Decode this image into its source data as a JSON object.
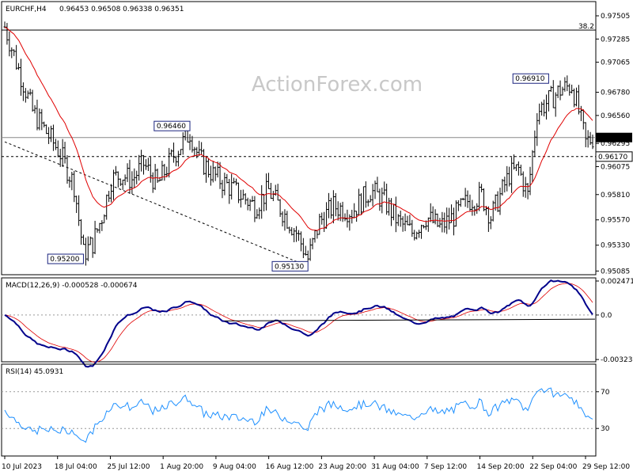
{
  "chart_data": [
    {
      "panel": "price",
      "type": "ohlc",
      "title": "EURCHF,H4",
      "ohlc_label": "0.96453 0.96508 0.96338 0.96351",
      "watermark": "ActionForex.com",
      "y_ticks": [
        "0.97505",
        "0.97285",
        "0.97065",
        "0.96780",
        "0.96560",
        "0.96295",
        "0.96075",
        "0.95810",
        "0.95570",
        "0.95330",
        "0.95085"
      ],
      "ylim": [
        0.9505,
        0.9764
      ],
      "x_ticks": [
        "10 Jul 2023",
        "18 Jul 04:00",
        "25 Jul 12:00",
        "1 Aug 20:00",
        "9 Aug 04:00",
        "16 Aug 12:00",
        "23 Aug 20:00",
        "31 Aug 04:00",
        "7 Sep 12:00",
        "14 Sep 20:00",
        "22 Sep 04:00",
        "29 Sep 12:00"
      ],
      "fib_label": "38.2",
      "fib_level": 0.9737,
      "current_price": 0.96351,
      "current_price_label": "0.96351",
      "support_level": 0.9617,
      "support_label": "0.96170",
      "annotations": [
        {
          "text": "0.95200",
          "bar": 34,
          "price": 0.952
        },
        {
          "text": "0.96460",
          "bar": 80,
          "price": 0.9646
        },
        {
          "text": "0.95130",
          "bar": 131,
          "price": 0.9513
        },
        {
          "text": "0.96910",
          "bar": 235,
          "price": 0.9691
        }
      ],
      "bar_count": 255,
      "series": [
        {
          "name": "price",
          "color": "#000000"
        },
        {
          "name": "moving average",
          "color": "#e00000"
        }
      ],
      "trendline": {
        "from": [
          0,
          0.9631
        ],
        "to": [
          131,
          0.9513
        ]
      }
    },
    {
      "panel": "macd",
      "type": "line",
      "title": "MACD(12,26,9) -0.000528 -0.000674",
      "y_ticks": [
        "0.002471",
        "0.0",
        "-0.003235"
      ],
      "ylim": [
        -0.0034,
        0.0027
      ],
      "series": [
        {
          "name": "MACD",
          "color": "#00008b"
        },
        {
          "name": "signal",
          "color": "#e00000"
        }
      ],
      "trendline": {
        "from": [
          95,
          -0.00043
        ],
        "to": [
          255,
          -0.0003
        ]
      }
    },
    {
      "panel": "rsi",
      "type": "line",
      "title": "RSI(14) 45.0931",
      "y_ticks": [
        "70",
        "30"
      ],
      "ylim": [
        0,
        100
      ],
      "levels": [
        70,
        30
      ],
      "series": [
        {
          "name": "RSI",
          "color": "#1e90ff"
        }
      ]
    }
  ],
  "colors": {
    "bars": "#000000",
    "ma": "#e00000",
    "macd": "#00008b",
    "signal": "#e00000",
    "rsi": "#1e90ff"
  }
}
